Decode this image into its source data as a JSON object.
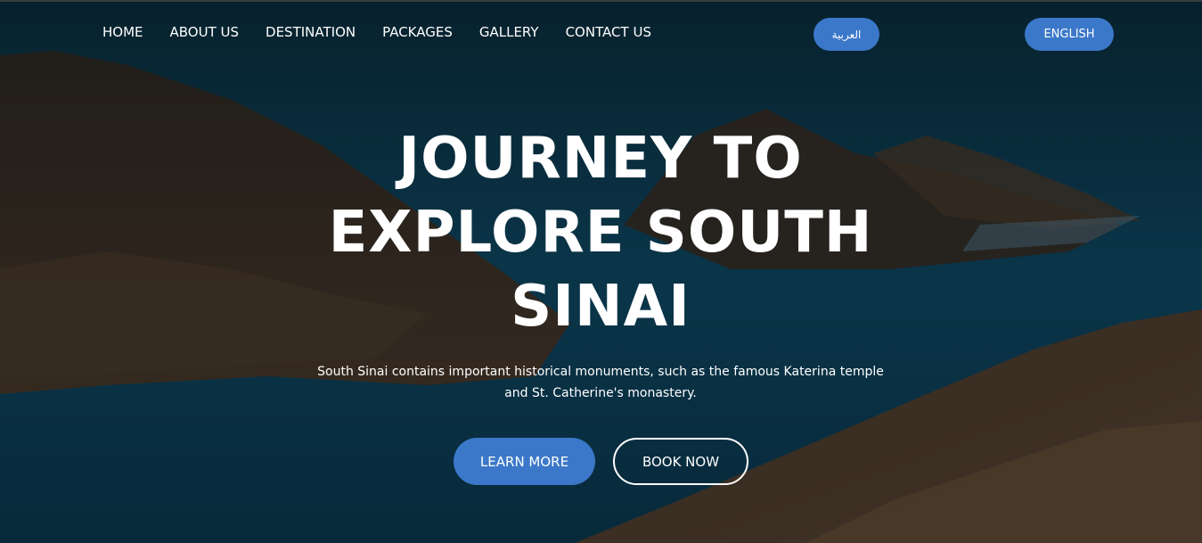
{
  "nav": {
    "items": [
      "HOME",
      "ABOUT US",
      "DESTINATION",
      "PACKAGES",
      "GALLERY",
      "CONTACT US"
    ]
  },
  "language": {
    "arabic_label": "العربية",
    "english_label": "ENGLISH"
  },
  "hero": {
    "headline_line1": "JOURNEY TO",
    "headline_line2": "EXPLORE SOUTH",
    "headline_line3": "SINAI",
    "subtitle_line1": "South Sinai contains important historical monuments, such as the famous Katerina temple",
    "subtitle_line2": "and St. Catherine's monastery.",
    "learn_more_label": "LEARN MORE",
    "book_now_label": "BOOK NOW"
  },
  "colors": {
    "accent": "#3b78c9",
    "sea": "#0e3a4c",
    "mountain": "#3a2f26"
  }
}
